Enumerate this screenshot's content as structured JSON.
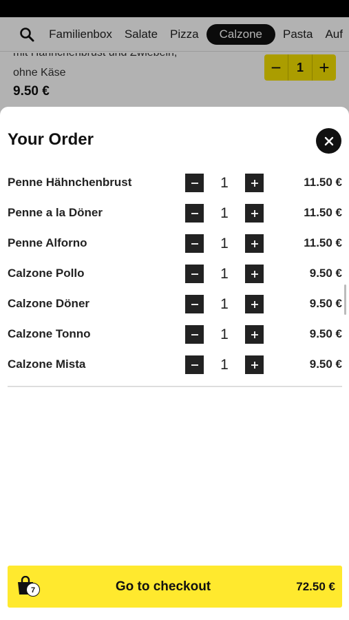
{
  "nav": {
    "search_icon": "search-icon",
    "categories": [
      {
        "label": "Familienbox",
        "active": false
      },
      {
        "label": "Salate",
        "active": false
      },
      {
        "label": "Pizza",
        "active": false
      },
      {
        "label": "Calzone",
        "active": true
      },
      {
        "label": "Pasta",
        "active": false
      },
      {
        "label": "Auf",
        "active": false
      }
    ]
  },
  "background_product": {
    "desc_cut": "mit Hähnchenbrust und Zwiebeln,",
    "desc": "ohne Käse",
    "price": "9.50 €",
    "minus": "−",
    "qty": "1",
    "plus": "+"
  },
  "order": {
    "title": "Your Order",
    "close_icon": "close-icon",
    "items": [
      {
        "name": "Penne Hähnchenbrust",
        "qty": "1",
        "price": "11.50 €"
      },
      {
        "name": "Penne a la Döner",
        "qty": "1",
        "price": "11.50 €"
      },
      {
        "name": "Penne Alforno",
        "qty": "1",
        "price": "11.50 €"
      },
      {
        "name": "Calzone Pollo",
        "qty": "1",
        "price": "9.50 €"
      },
      {
        "name": "Calzone Döner",
        "qty": "1",
        "price": "9.50 €"
      },
      {
        "name": "Calzone Tonno",
        "qty": "1",
        "price": "9.50 €"
      },
      {
        "name": "Calzone Mista",
        "qty": "1",
        "price": "9.50 €"
      }
    ]
  },
  "checkout": {
    "bag_count": "7",
    "label": "Go to checkout",
    "total": "72.50 €"
  },
  "colors": {
    "accent_yellow": "#ffe92e",
    "dark": "#111111"
  }
}
